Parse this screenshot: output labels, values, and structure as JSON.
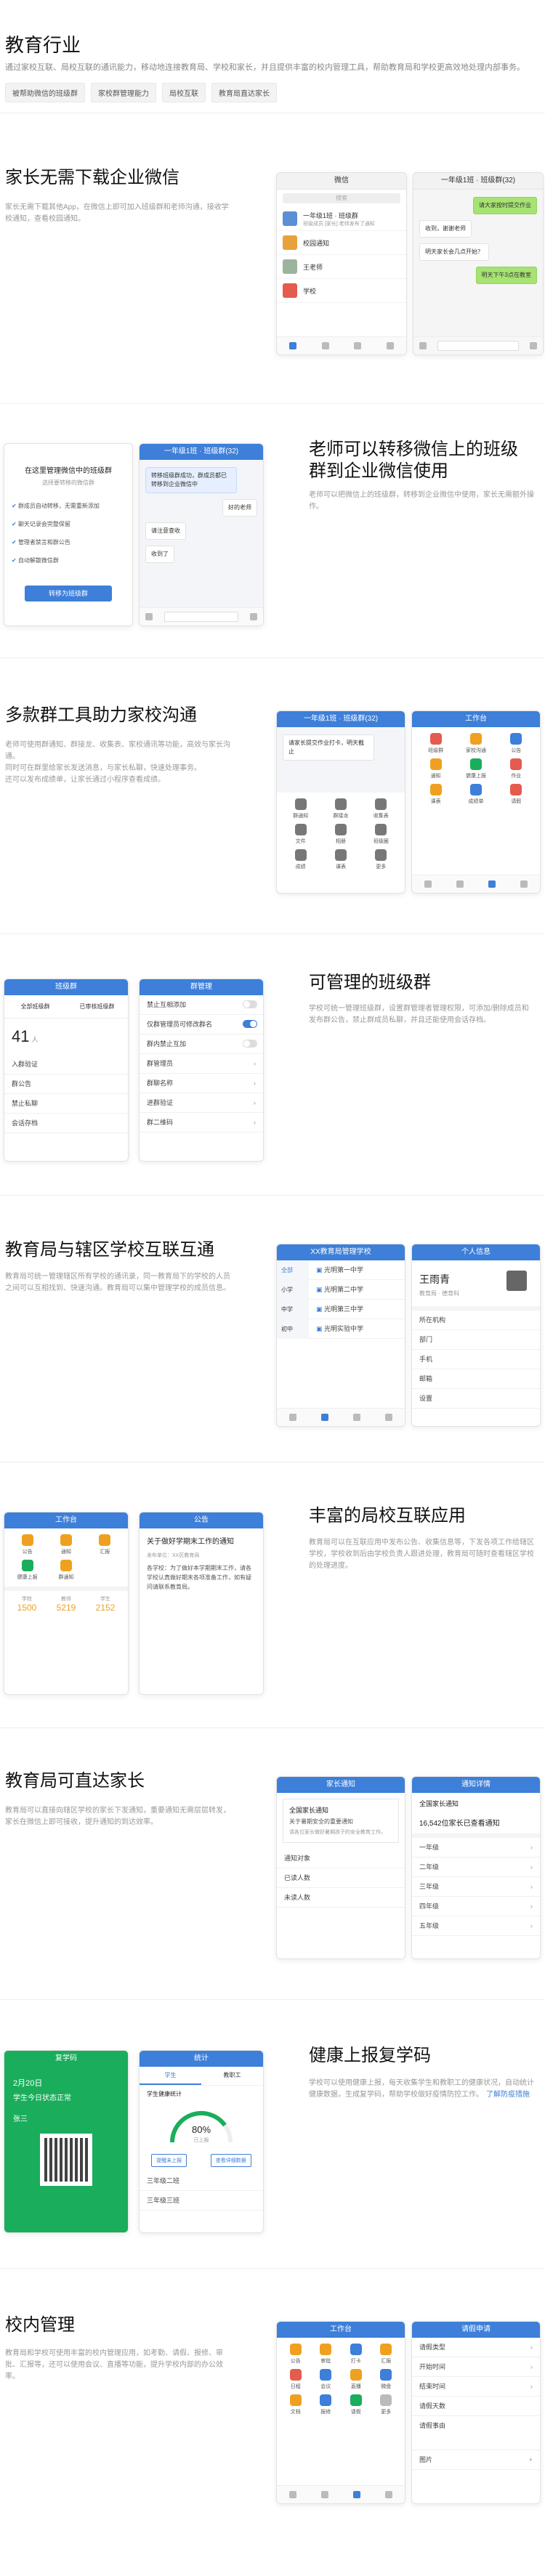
{
  "hero": {
    "title": "教育行业",
    "desc": "通过家校互联、局校互联的通讯能力，移动地连接教育局、学校和家长，并且提供丰富的校内管理工具，帮助教育局和学校更高效地处理内部事务。",
    "tags": [
      "被帮助微信的班级群",
      "家校群管理能力",
      "局校互联",
      "教育局直达家长"
    ]
  },
  "s1": {
    "title": "家长无需下载企业微信",
    "desc": "家长无需下载其他App，在微信上即可加入班级群和老师沟通，接收学校通知，查看校园通知。",
    "p1": {
      "bar": "微信",
      "search": "搜索",
      "chats": [
        "一年级1班 · 班级群",
        "校园通知",
        "王老师",
        "学校"
      ],
      "sub": "班级成员 [家长] 老师发布了通知"
    },
    "p2": {
      "bar": "一年级1班 · 班级群(32)",
      "msgs": [
        "请大家按时提交作业",
        "收到，谢谢老师",
        "明天家长会几点开始？",
        "明天下午3点在教室"
      ]
    }
  },
  "s2": {
    "title": "老师可以转移微信上的班级群到企业微信使用",
    "desc": "老师可以把微信上的班级群，转移到企业微信中使用，家长无需额外操作。",
    "p1": {
      "title": "在这里管理微信中的班级群",
      "sub": "选择要转移的微信群",
      "items": [
        "群成员自动转移，无需重新添加",
        "聊天记录会完整保留",
        "管理者禁言和群公告",
        "自动解散微信群"
      ],
      "btn": "转移为班级群"
    },
    "p2": {
      "bar": "一年级1班 · 班级群(32)",
      "msgs": [
        "转移班级群成功，群成员都已转移到企业微信中",
        "好的老师",
        "请注意查收",
        "收到了"
      ]
    }
  },
  "s3": {
    "title": "多款群工具助力家校沟通",
    "desc1": "老师可使用群通知、群接龙、收集表、家校通讯等功能，高效与家长沟通。",
    "desc2": "同时可在群里给家长发送消息，与家长私聊，快速处理事务。",
    "desc3": "还可以发布成绩单，让家长通过小程序查看成绩。",
    "p1": {
      "bar": "一年级1班 · 班级群(32)",
      "msg": "请家长提交作业打卡，明天截止",
      "tools": [
        "群通知",
        "群接龙",
        "收集表",
        "文件",
        "相册",
        "班级圈",
        "成绩",
        "课表",
        "更多"
      ]
    },
    "p2": {
      "bar": "工作台",
      "apps": [
        "班级群",
        "家校沟通",
        "公告",
        "通知",
        "健康上报",
        "作业",
        "课表",
        "成绩单",
        "请假"
      ]
    }
  },
  "s4": {
    "title": "可管理的班级群",
    "desc": "学校可统一管理班级群，设置群管理者管理权限，可添加/删除成员和发布群公告，禁止群成员私聊，并且还能使用会话存档。",
    "p1": {
      "bar": "班级群",
      "stats": [
        "全部班级群",
        "已审核班级群"
      ],
      "count": "41",
      "unit": "人",
      "items": [
        "入群验证",
        "群公告",
        "禁止私聊",
        "会话存档"
      ]
    },
    "p2": {
      "bar": "群管理",
      "rows": [
        "禁止互相添加",
        "仅群管理员可修改群名",
        "群内禁止互加",
        "群管理员",
        "群聊名称",
        "进群验证",
        "群二维码"
      ],
      "toggles": [
        false,
        true,
        false
      ]
    }
  },
  "s5": {
    "title": "教育局与辖区学校互联互通",
    "desc": "教育局可统一管理辖区所有学校的通讯录，同一教育局下的学校的人员之间可以互相找到、快速沟通。教育局可以集中管理学校的成员信息。",
    "p1": {
      "bar": "XX教育局管理学校",
      "cats": [
        "全部",
        "小学",
        "中学",
        "初中"
      ],
      "list": [
        "光明第一中学",
        "光明第二中学",
        "光明第三中学",
        "光明实验中学"
      ]
    },
    "p2": {
      "bar": "个人信息",
      "name": "王雨青",
      "role": "教育局 · 德育科",
      "rows": [
        "所在机构",
        "部门",
        "手机",
        "邮箱",
        "设置"
      ]
    }
  },
  "s6": {
    "title": "丰富的局校互联应用",
    "desc": "教育局可以在互联应用中发布公告、收集信息等，下发各项工作给辖区学校，学校收到后由学校负责人跟进处理，教育局可随时查看辖区学校的处理进度。",
    "p1": {
      "bar": "工作台",
      "apps": [
        "公告",
        "通知",
        "汇报",
        "健康上报",
        "群通知"
      ],
      "stats": [
        {
          "label": "学校",
          "value": "1500"
        },
        {
          "label": "教师",
          "value": "5219"
        },
        {
          "label": "学生",
          "value": "2152"
        }
      ]
    },
    "p2": {
      "bar": "公告",
      "title": "关于做好学期末工作的通知",
      "meta": "发布单位：XX区教育局",
      "body": "各学校：为了做好本学期期末工作，请各学校认真做好期末各项准备工作，如有疑问请联系教育局。"
    }
  },
  "s7": {
    "title": "教育局可直达家长",
    "desc": "教育局可以直接向辖区学校的家长下发通知，重要通知无需层层转发，家长在微信上即可接收，提升通知的到达效率。",
    "p1": {
      "bar": "家长通知",
      "title": "全国家长通知",
      "sub": "关于暑期安全的重要通知",
      "body": "请各位家长做好暑期孩子的安全教育工作。",
      "rows": [
        "通知对象",
        "已读人数",
        "未读人数"
      ]
    },
    "p2": {
      "bar": "通知详情",
      "head": "全国家长通知",
      "count": "16,542位家长已查看通知",
      "rows": [
        "一年级",
        "二年级",
        "三年级",
        "四年级",
        "五年级"
      ]
    }
  },
  "s8": {
    "title": "健康上报复学码",
    "desc": "学校可以使用健康上报，每天收集学生和教职工的健康状况，自动统计健康数据，生成复学码，帮助学校做好疫情防控工作。",
    "link": "了解防疫措施",
    "p1": {
      "bar": "复学码",
      "date": "2月20日",
      "status": "学生今日状态正常",
      "name": "张三"
    },
    "p2": {
      "bar": "统计",
      "tabs": [
        "学生",
        "教职工"
      ],
      "head": "学生健康统计",
      "pct": "80%",
      "label": "已上报",
      "btns": [
        "提醒未上报",
        "查看详细数据"
      ],
      "rows": [
        "三年级二班",
        "三年级三班"
      ]
    }
  },
  "s9": {
    "title": "校内管理",
    "desc": "教育局和学校可使用丰富的校内管理应用，如考勤、请假、报修、审批、汇报等，还可以使用会议、直播等功能，提升学校内部的办公效率。",
    "p1": {
      "bar": "工作台",
      "apps": [
        "公告",
        "审批",
        "打卡",
        "汇报",
        "日程",
        "会议",
        "直播",
        "微盘",
        "文档",
        "报修",
        "请假",
        "更多"
      ]
    },
    "p2": {
      "bar": "请假申请",
      "rows": [
        "请假类型",
        "开始时间",
        "结束时间",
        "请假天数",
        "请假事由",
        "图片"
      ]
    }
  }
}
